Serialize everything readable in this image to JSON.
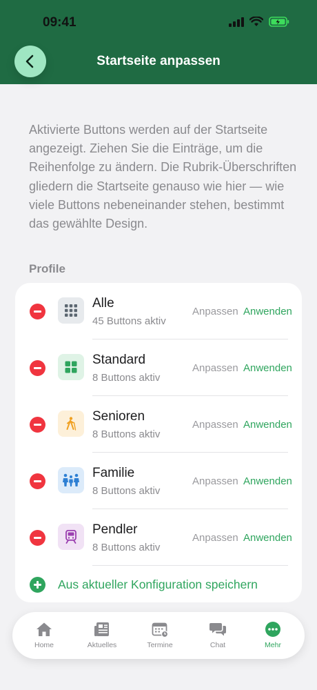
{
  "status_bar": {
    "time": "09:41"
  },
  "header": {
    "title": "Startseite anpassen",
    "back_icon": "chevron-left-icon"
  },
  "description": "Aktivierte Buttons werden auf der Startseite angezeigt. Ziehen Sie die Einträge, um die Reihenfolge zu ändern. Die Rubrik-Überschriften gliedern die Startseite genauso wie hier — wie viele Buttons nebeneinander stehen, bestimmt das gewählte Design.",
  "section": {
    "label": "Profile"
  },
  "profiles": [
    {
      "name": "Alle",
      "subtitle": "45 Buttons aktiv",
      "adjust": "Anpassen",
      "apply": "Anwenden",
      "icon": "grid-icon",
      "color": "#5b6670",
      "bg": "#e7eaed"
    },
    {
      "name": "Standard",
      "subtitle": "8 Buttons aktiv",
      "adjust": "Anpassen",
      "apply": "Anwenden",
      "icon": "squares-icon",
      "color": "#2fa55e",
      "bg": "#dff3e6"
    },
    {
      "name": "Senioren",
      "subtitle": "8 Buttons aktiv",
      "adjust": "Anpassen",
      "apply": "Anwenden",
      "icon": "walker-icon",
      "color": "#f0a020",
      "bg": "#fdf0d9"
    },
    {
      "name": "Familie",
      "subtitle": "8 Buttons aktiv",
      "adjust": "Anpassen",
      "apply": "Anwenden",
      "icon": "family-icon",
      "color": "#2d7fd3",
      "bg": "#dcebfa"
    },
    {
      "name": "Pendler",
      "subtitle": "8 Buttons aktiv",
      "adjust": "Anpassen",
      "apply": "Anwenden",
      "icon": "train-icon",
      "color": "#9b3fb0",
      "bg": "#f1e2f5"
    }
  ],
  "add_action": {
    "label": "Aus aktueller Konfiguration speichern"
  },
  "tabbar": {
    "items": [
      {
        "label": "Home",
        "icon": "home-icon"
      },
      {
        "label": "Aktuelles",
        "icon": "news-icon"
      },
      {
        "label": "Termine",
        "icon": "calendar-icon"
      },
      {
        "label": "Chat",
        "icon": "chat-icon"
      },
      {
        "label": "Mehr",
        "icon": "more-icon",
        "active": true
      }
    ]
  },
  "colors": {
    "header": "#1f6b43",
    "accent": "#2fa55e",
    "danger": "#f0353f"
  }
}
